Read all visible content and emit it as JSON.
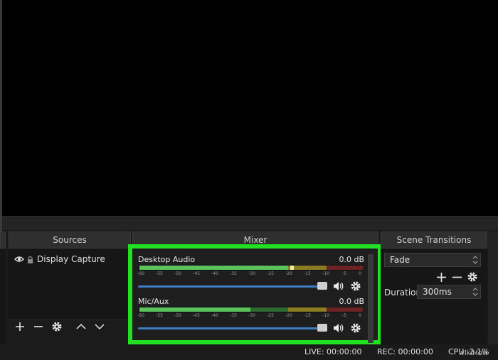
{
  "docks": {
    "sources": {
      "title": "Sources",
      "items": [
        {
          "label": "Display Capture"
        }
      ]
    },
    "mixer": {
      "title": "Mixer",
      "channels": [
        {
          "name": "Desktop Audio",
          "level": "0.0 dB"
        },
        {
          "name": "Mic/Aux",
          "level": "0.0 dB"
        }
      ],
      "scale_labels": [
        "-60",
        "-55",
        "-50",
        "-45",
        "-40",
        "-35",
        "-30",
        "-25",
        "-20",
        "-15",
        "-10",
        "-5",
        "0"
      ]
    },
    "scene_transitions": {
      "title": "Scene Transitions",
      "transition": "Fade",
      "duration_label": "Duration",
      "duration_value": "300ms"
    }
  },
  "status": {
    "live": "LIVE: 00:00:00",
    "rec": "REC: 00:00:00",
    "cpu": "CPU: 2.1%"
  },
  "watermark": "wikiHow",
  "colors": {
    "highlight": "#22e022",
    "meter_green": "#5cc25c",
    "meter_yellow": "#c8b435",
    "meter_red": "#b83a3a",
    "slider": "#3e7cc8"
  },
  "icons": {
    "visibility": "eye-icon",
    "locked": "lock-icon",
    "add": "plus-icon",
    "remove": "minus-icon",
    "settings": "gear-icon",
    "move_up": "chevron-up-icon",
    "move_down": "chevron-down-icon",
    "volume": "speaker-icon"
  }
}
